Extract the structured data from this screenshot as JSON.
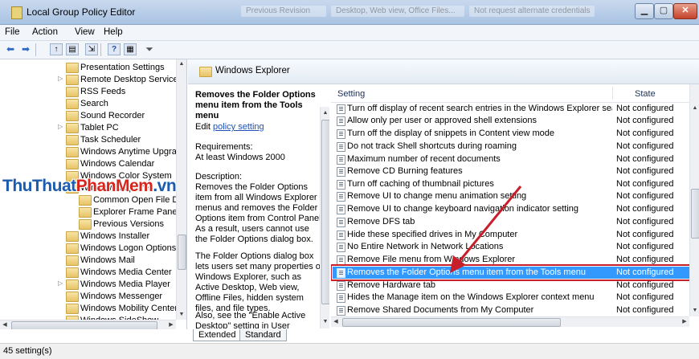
{
  "window": {
    "title": "Local Group Policy Editor"
  },
  "taskbar_blur": [
    "Previous Revision",
    "Desktop, Web view, Office Files...",
    "Not request alternate credentials"
  ],
  "menu": [
    "File",
    "Action",
    "View",
    "Help"
  ],
  "tree": {
    "items": [
      {
        "label": "Presentation Settings",
        "expander": ""
      },
      {
        "label": "Remote Desktop Services",
        "expander": "▷"
      },
      {
        "label": "RSS Feeds",
        "expander": ""
      },
      {
        "label": "Search",
        "expander": ""
      },
      {
        "label": "Sound Recorder",
        "expander": ""
      },
      {
        "label": "Tablet PC",
        "expander": "▷"
      },
      {
        "label": "Task Scheduler",
        "expander": ""
      },
      {
        "label": "Windows Anytime Upgrade",
        "expander": ""
      },
      {
        "label": "Windows Calendar",
        "expander": ""
      },
      {
        "label": "Windows Color System",
        "expander": ""
      },
      {
        "label": "Windows Explorer",
        "expander": "◢"
      },
      {
        "label": "Common Open File Dia",
        "expander": ""
      },
      {
        "label": "Explorer Frame Pane",
        "expander": ""
      },
      {
        "label": "Previous Versions",
        "expander": ""
      },
      {
        "label": "Windows Installer",
        "expander": ""
      },
      {
        "label": "Windows Logon Options",
        "expander": ""
      },
      {
        "label": "Windows Mail",
        "expander": ""
      },
      {
        "label": "Windows Media Center",
        "expander": ""
      },
      {
        "label": "Windows Media Player",
        "expander": "▷"
      },
      {
        "label": "Windows Messenger",
        "expander": ""
      },
      {
        "label": "Windows Mobility Center",
        "expander": ""
      },
      {
        "label": "Windows SideShow",
        "expander": ""
      }
    ]
  },
  "watermark": {
    "part1": "ThuThuat",
    "part2": "PhanMem",
    "part3": ".vn"
  },
  "header": {
    "title": "Windows Explorer"
  },
  "description": {
    "title": "Removes the Folder Options menu item from the Tools menu",
    "edit_prefix": "Edit",
    "edit_link": "policy setting",
    "requirements_label": "Requirements:",
    "requirements_value": "At least Windows 2000",
    "description_label": "Description:",
    "description_text": "Removes the Folder Options item from all Windows Explorer menus and removes the Folder Options item from Control Panel. As a result, users cannot use the Folder Options dialog box.",
    "description_text2": "The Folder Options dialog box lets users set many properties of Windows Explorer, such as Active Desktop, Web view, Offline Files, hidden system files, and file types.",
    "description_text3": "Also, see the \"Enable Active Desktop\" setting in User"
  },
  "table": {
    "col_setting": "Setting",
    "col_state": "State",
    "rows": [
      {
        "name": "Turn off display of recent search entries in the Windows Explorer search b...",
        "state": "Not configured"
      },
      {
        "name": "Allow only per user or approved shell extensions",
        "state": "Not configured"
      },
      {
        "name": "Turn off the display of snippets in Content view mode",
        "state": "Not configured"
      },
      {
        "name": "Do not track Shell shortcuts during roaming",
        "state": "Not configured"
      },
      {
        "name": "Maximum number of recent documents",
        "state": "Not configured"
      },
      {
        "name": "Remove CD Burning features",
        "state": "Not configured"
      },
      {
        "name": "Turn off caching of thumbnail pictures",
        "state": "Not configured"
      },
      {
        "name": "Remove UI to change menu animation setting",
        "state": "Not configured"
      },
      {
        "name": "Remove UI to change keyboard navigation indicator setting",
        "state": "Not configured"
      },
      {
        "name": "Remove DFS tab",
        "state": "Not configured"
      },
      {
        "name": "Hide these specified drives in My Computer",
        "state": "Not configured"
      },
      {
        "name": "No Entire Network in Network Locations",
        "state": "Not configured"
      },
      {
        "name": "Remove File menu from Windows Explorer",
        "state": "Not configured"
      },
      {
        "name": "Removes the Folder Options menu item from the Tools menu",
        "state": "Not configured"
      },
      {
        "name": "Remove Hardware tab",
        "state": "Not configured"
      },
      {
        "name": "Hides the Manage item on the Windows Explorer context menu",
        "state": "Not configured"
      },
      {
        "name": "Remove Shared Documents from My Computer",
        "state": "Not configured"
      }
    ],
    "selected_index": 13
  },
  "tabs": [
    "Extended",
    "Standard"
  ],
  "status": {
    "text": "45 setting(s)"
  },
  "colors": {
    "selection": "#3399ff",
    "highlight_border": "#c8202a",
    "arrow": "#c8202a"
  }
}
